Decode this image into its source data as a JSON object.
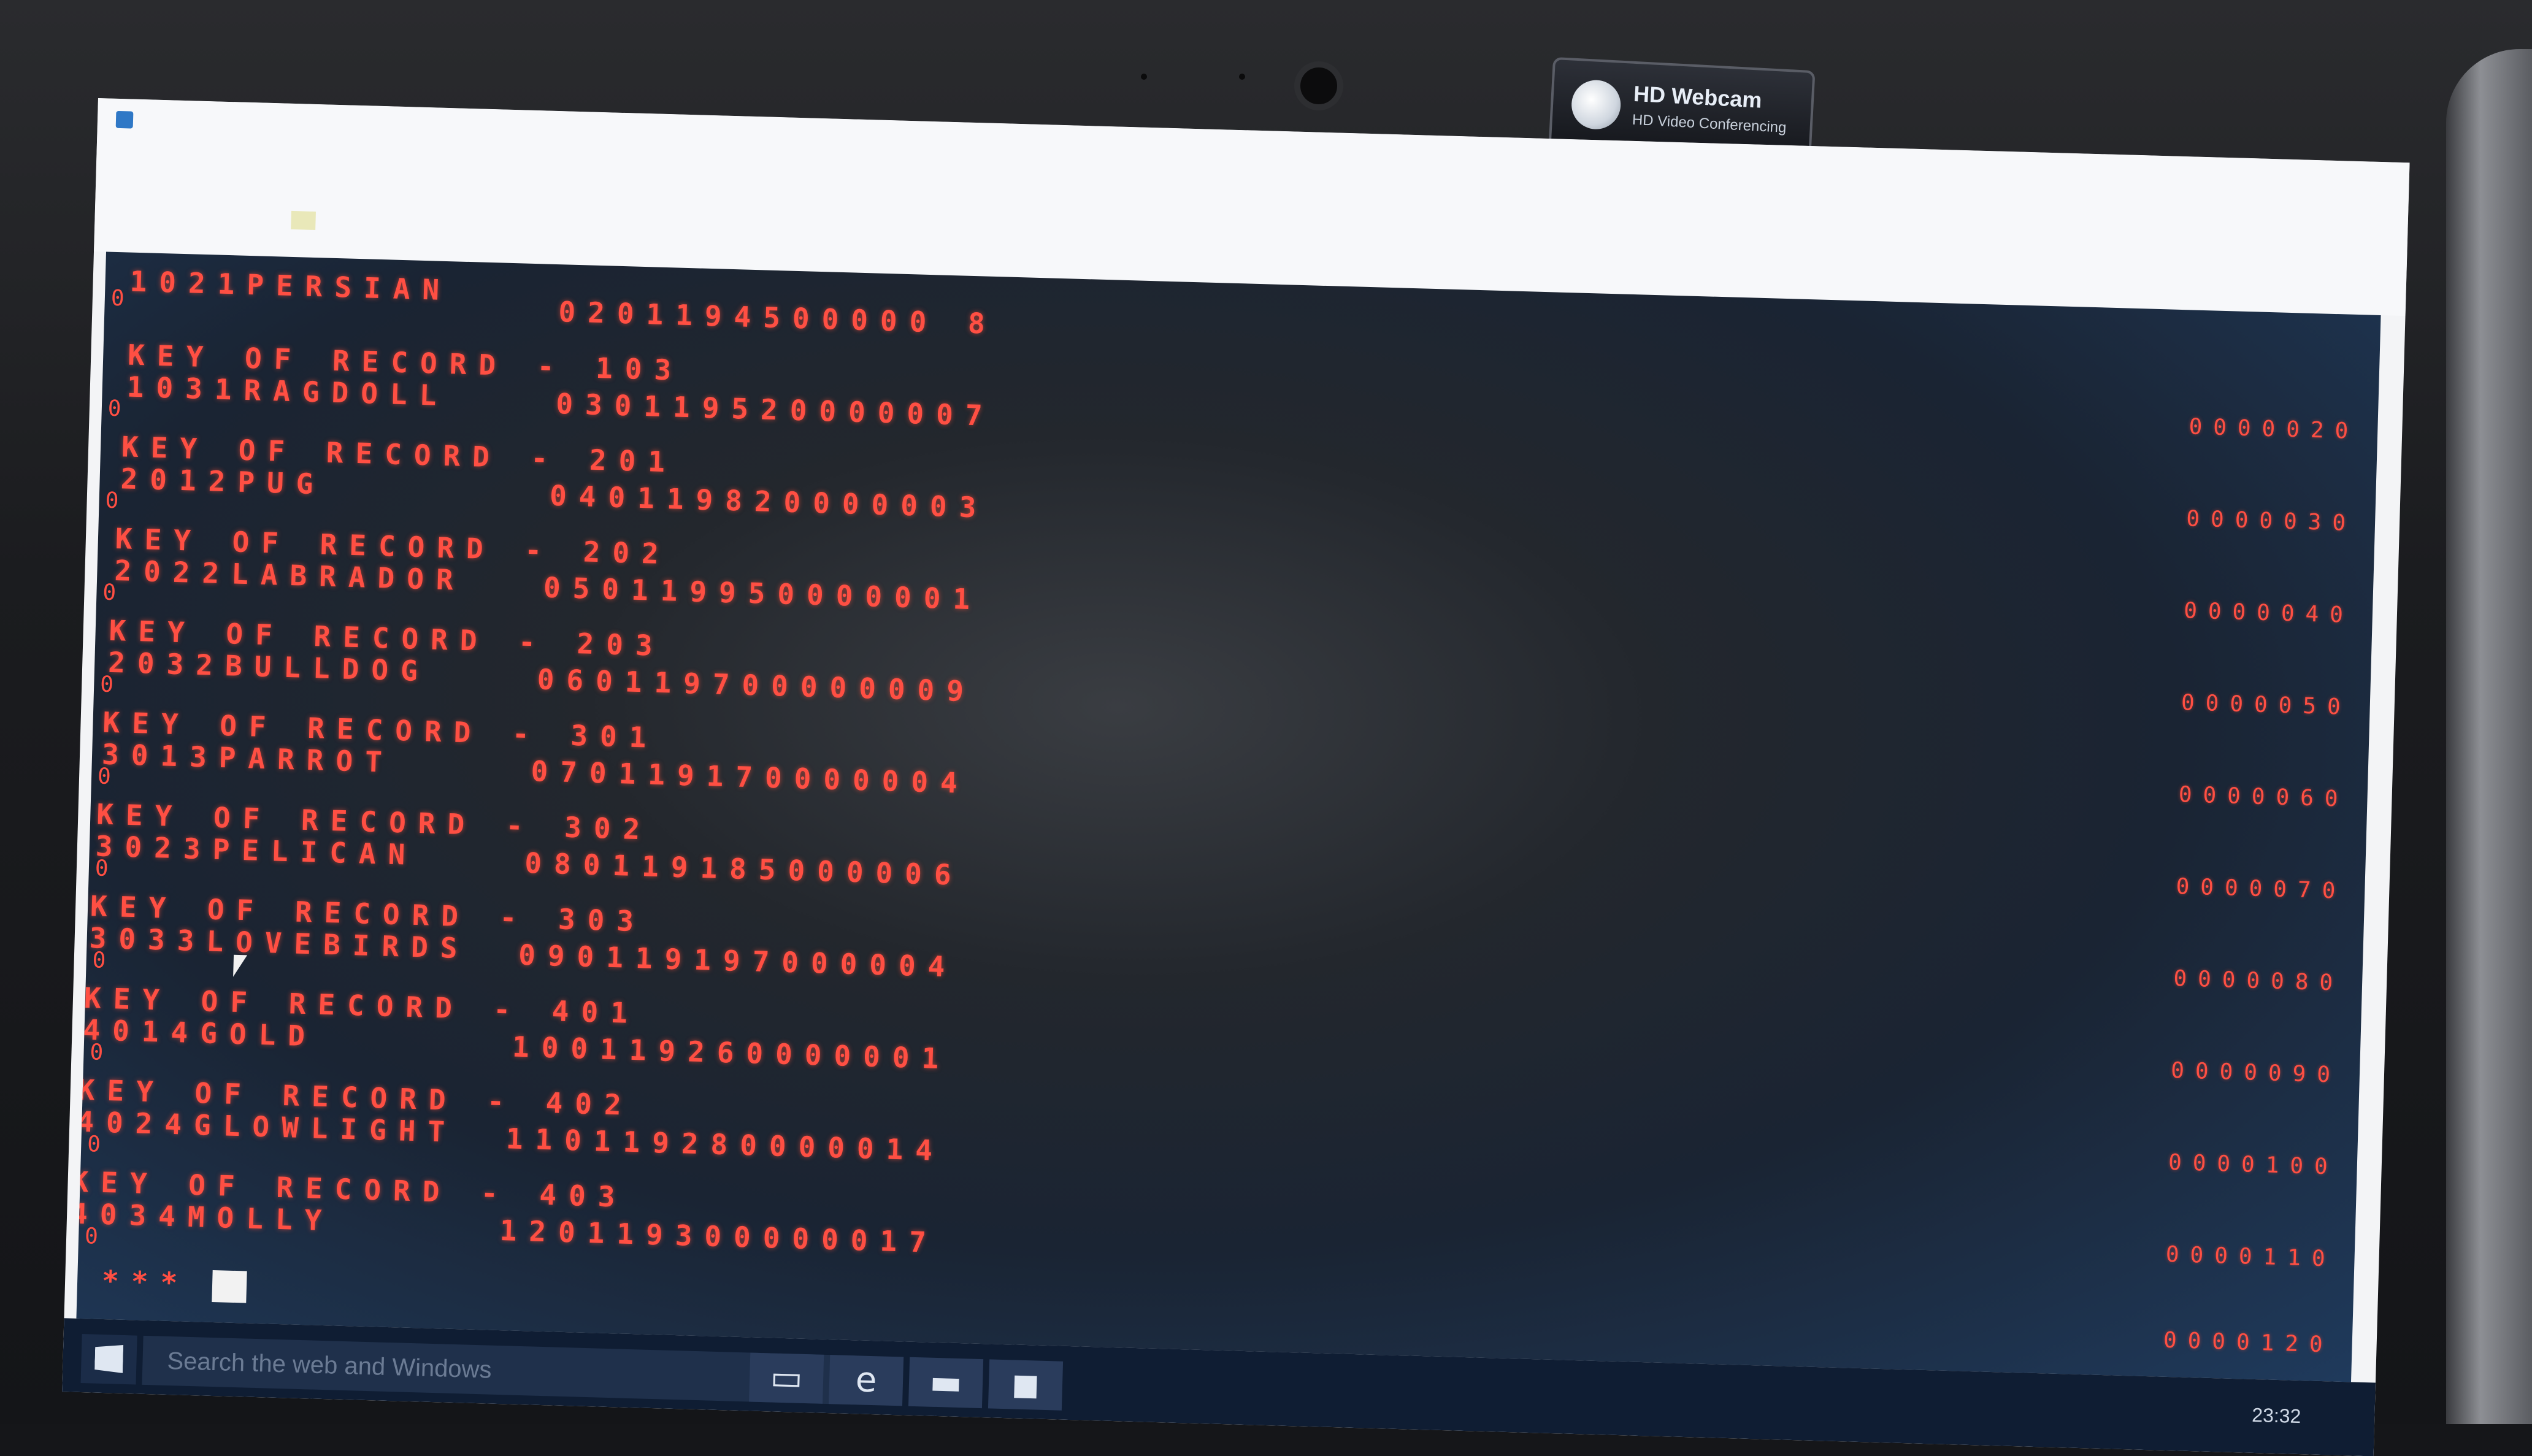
{
  "webcam_sticker": {
    "title": "HD Webcam",
    "subtitle": "HD Video Conferencing"
  },
  "console": {
    "first_line": {
      "label": "1021PERSIAN",
      "value": "0201194500000 8"
    },
    "records": [
      {
        "key_label": "KEY OF RECORD - 103",
        "name": "1031RAGDOLL",
        "value": "030119520000007",
        "counter": "0000020"
      },
      {
        "key_label": "KEY OF RECORD - 201",
        "name": "2012PUG",
        "value": "040119820000003",
        "counter": "0000030"
      },
      {
        "key_label": "KEY OF RECORD - 202",
        "name": "2022LABRADOR",
        "value": "050119950000001",
        "counter": "0000040"
      },
      {
        "key_label": "KEY OF RECORD - 203",
        "name": "2032BULLDOG",
        "value": "060119700000009",
        "counter": "0000050"
      },
      {
        "key_label": "KEY OF RECORD - 301",
        "name": "3013PARROT",
        "value": "070119170000004",
        "counter": "0000060"
      },
      {
        "key_label": "KEY OF RECORD - 302",
        "name": "3023PELICAN",
        "value": "080119185000006",
        "counter": "0000070"
      },
      {
        "key_label": "KEY OF RECORD - 303",
        "name": "3033LOVEBIRDS",
        "value": "090119197000004",
        "counter": "0000080"
      },
      {
        "key_label": "KEY OF RECORD - 401",
        "name": "4014GOLD",
        "value": "100119260000001",
        "counter": "0000090"
      },
      {
        "key_label": "KEY OF RECORD - 402",
        "name": "4024GLOWLIGHT",
        "value": "110119280000014",
        "counter": "0000100"
      },
      {
        "key_label": "KEY OF RECORD - 403",
        "name": "4034MOLLY",
        "value": "120119300000017",
        "counter": "0000110"
      }
    ],
    "zero_marker": "0",
    "prompt": "***",
    "last_counter": "0000120"
  },
  "taskbar": {
    "search_placeholder": "Search the web and Windows",
    "icons": [
      "task-view-icon",
      "edge-icon",
      "file-explorer-icon",
      "store-icon"
    ],
    "clock": "23:32"
  }
}
